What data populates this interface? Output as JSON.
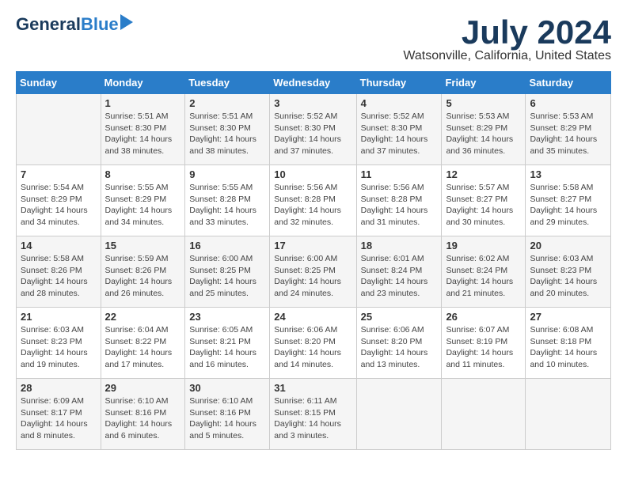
{
  "logo": {
    "general": "General",
    "blue": "Blue"
  },
  "header": {
    "month": "July 2024",
    "location": "Watsonville, California, United States"
  },
  "days_of_week": [
    "Sunday",
    "Monday",
    "Tuesday",
    "Wednesday",
    "Thursday",
    "Friday",
    "Saturday"
  ],
  "weeks": [
    [
      {
        "day": "",
        "info": ""
      },
      {
        "day": "1",
        "info": "Sunrise: 5:51 AM\nSunset: 8:30 PM\nDaylight: 14 hours\nand 38 minutes."
      },
      {
        "day": "2",
        "info": "Sunrise: 5:51 AM\nSunset: 8:30 PM\nDaylight: 14 hours\nand 38 minutes."
      },
      {
        "day": "3",
        "info": "Sunrise: 5:52 AM\nSunset: 8:30 PM\nDaylight: 14 hours\nand 37 minutes."
      },
      {
        "day": "4",
        "info": "Sunrise: 5:52 AM\nSunset: 8:30 PM\nDaylight: 14 hours\nand 37 minutes."
      },
      {
        "day": "5",
        "info": "Sunrise: 5:53 AM\nSunset: 8:29 PM\nDaylight: 14 hours\nand 36 minutes."
      },
      {
        "day": "6",
        "info": "Sunrise: 5:53 AM\nSunset: 8:29 PM\nDaylight: 14 hours\nand 35 minutes."
      }
    ],
    [
      {
        "day": "7",
        "info": "Sunrise: 5:54 AM\nSunset: 8:29 PM\nDaylight: 14 hours\nand 34 minutes."
      },
      {
        "day": "8",
        "info": "Sunrise: 5:55 AM\nSunset: 8:29 PM\nDaylight: 14 hours\nand 34 minutes."
      },
      {
        "day": "9",
        "info": "Sunrise: 5:55 AM\nSunset: 8:28 PM\nDaylight: 14 hours\nand 33 minutes."
      },
      {
        "day": "10",
        "info": "Sunrise: 5:56 AM\nSunset: 8:28 PM\nDaylight: 14 hours\nand 32 minutes."
      },
      {
        "day": "11",
        "info": "Sunrise: 5:56 AM\nSunset: 8:28 PM\nDaylight: 14 hours\nand 31 minutes."
      },
      {
        "day": "12",
        "info": "Sunrise: 5:57 AM\nSunset: 8:27 PM\nDaylight: 14 hours\nand 30 minutes."
      },
      {
        "day": "13",
        "info": "Sunrise: 5:58 AM\nSunset: 8:27 PM\nDaylight: 14 hours\nand 29 minutes."
      }
    ],
    [
      {
        "day": "14",
        "info": "Sunrise: 5:58 AM\nSunset: 8:26 PM\nDaylight: 14 hours\nand 28 minutes."
      },
      {
        "day": "15",
        "info": "Sunrise: 5:59 AM\nSunset: 8:26 PM\nDaylight: 14 hours\nand 26 minutes."
      },
      {
        "day": "16",
        "info": "Sunrise: 6:00 AM\nSunset: 8:25 PM\nDaylight: 14 hours\nand 25 minutes."
      },
      {
        "day": "17",
        "info": "Sunrise: 6:00 AM\nSunset: 8:25 PM\nDaylight: 14 hours\nand 24 minutes."
      },
      {
        "day": "18",
        "info": "Sunrise: 6:01 AM\nSunset: 8:24 PM\nDaylight: 14 hours\nand 23 minutes."
      },
      {
        "day": "19",
        "info": "Sunrise: 6:02 AM\nSunset: 8:24 PM\nDaylight: 14 hours\nand 21 minutes."
      },
      {
        "day": "20",
        "info": "Sunrise: 6:03 AM\nSunset: 8:23 PM\nDaylight: 14 hours\nand 20 minutes."
      }
    ],
    [
      {
        "day": "21",
        "info": "Sunrise: 6:03 AM\nSunset: 8:23 PM\nDaylight: 14 hours\nand 19 minutes."
      },
      {
        "day": "22",
        "info": "Sunrise: 6:04 AM\nSunset: 8:22 PM\nDaylight: 14 hours\nand 17 minutes."
      },
      {
        "day": "23",
        "info": "Sunrise: 6:05 AM\nSunset: 8:21 PM\nDaylight: 14 hours\nand 16 minutes."
      },
      {
        "day": "24",
        "info": "Sunrise: 6:06 AM\nSunset: 8:20 PM\nDaylight: 14 hours\nand 14 minutes."
      },
      {
        "day": "25",
        "info": "Sunrise: 6:06 AM\nSunset: 8:20 PM\nDaylight: 14 hours\nand 13 minutes."
      },
      {
        "day": "26",
        "info": "Sunrise: 6:07 AM\nSunset: 8:19 PM\nDaylight: 14 hours\nand 11 minutes."
      },
      {
        "day": "27",
        "info": "Sunrise: 6:08 AM\nSunset: 8:18 PM\nDaylight: 14 hours\nand 10 minutes."
      }
    ],
    [
      {
        "day": "28",
        "info": "Sunrise: 6:09 AM\nSunset: 8:17 PM\nDaylight: 14 hours\nand 8 minutes."
      },
      {
        "day": "29",
        "info": "Sunrise: 6:10 AM\nSunset: 8:16 PM\nDaylight: 14 hours\nand 6 minutes."
      },
      {
        "day": "30",
        "info": "Sunrise: 6:10 AM\nSunset: 8:16 PM\nDaylight: 14 hours\nand 5 minutes."
      },
      {
        "day": "31",
        "info": "Sunrise: 6:11 AM\nSunset: 8:15 PM\nDaylight: 14 hours\nand 3 minutes."
      },
      {
        "day": "",
        "info": ""
      },
      {
        "day": "",
        "info": ""
      },
      {
        "day": "",
        "info": ""
      }
    ]
  ]
}
